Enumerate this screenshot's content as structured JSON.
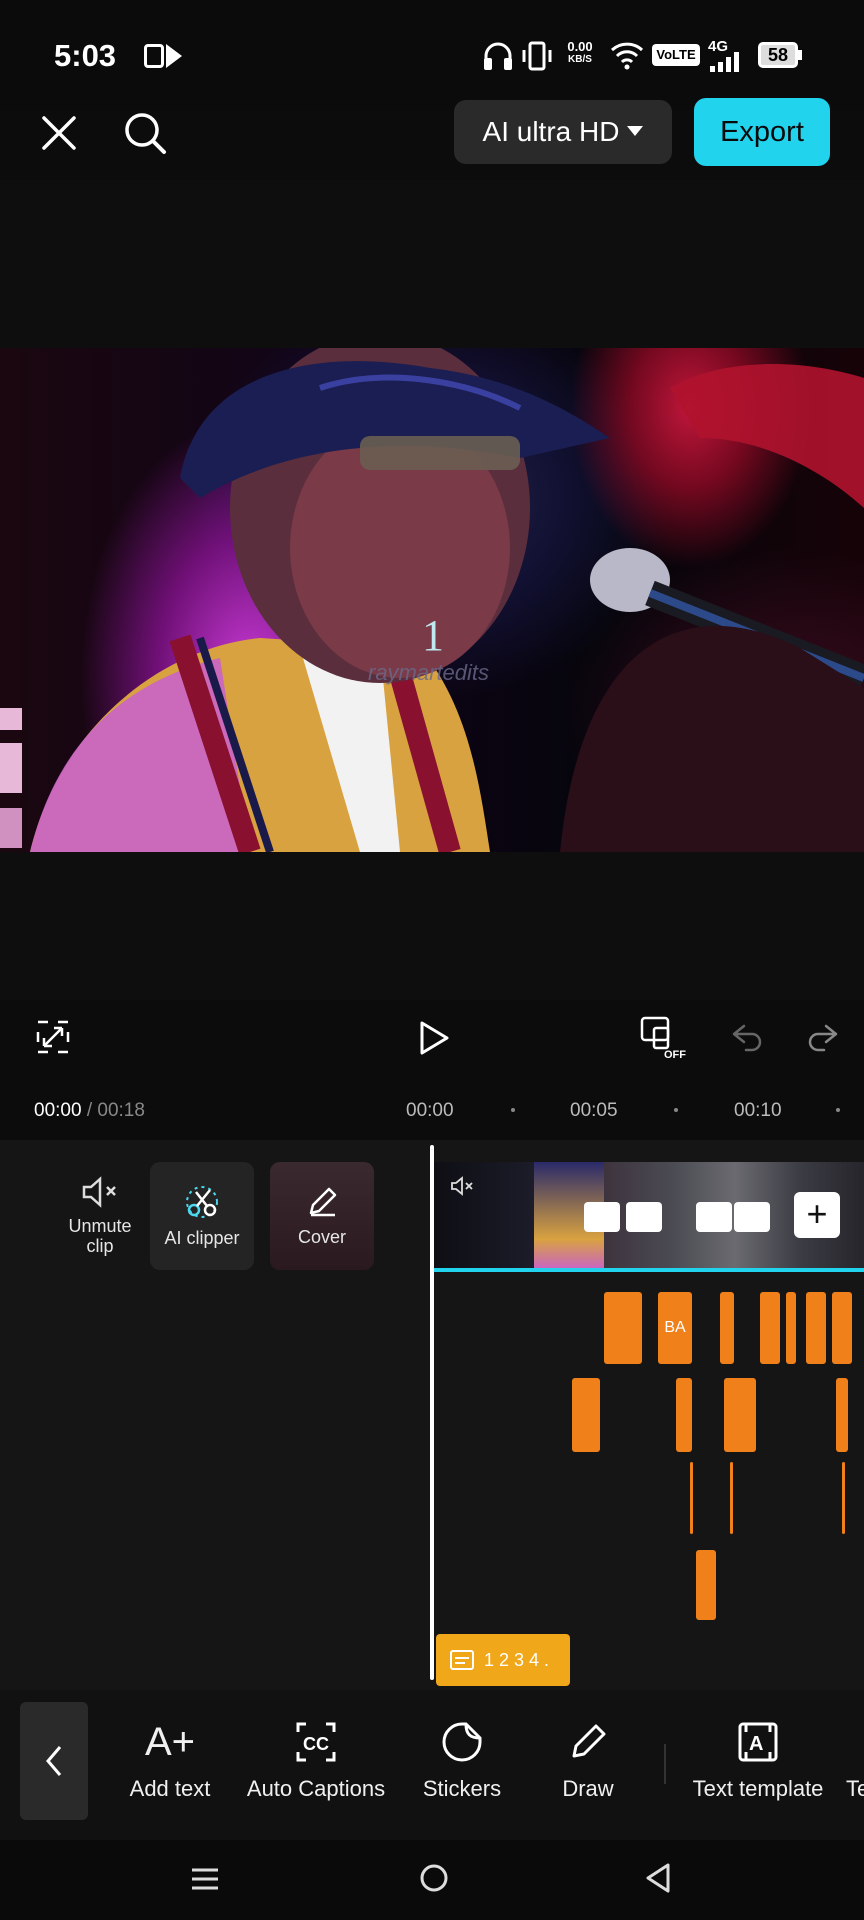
{
  "status_bar": {
    "time": "5:03",
    "net_speed_value": "0.00",
    "net_speed_unit": "KB/S",
    "volte": "VoLTE",
    "network": "4G",
    "battery": "58",
    "icons": [
      "headphones-icon",
      "vibrate-icon",
      "wifi-icon",
      "signal-icon",
      "battery-icon"
    ]
  },
  "top_bar": {
    "quality_label": "AI ultra HD",
    "export_label": "Export"
  },
  "preview": {
    "overlay_number": "1",
    "watermark": "raymartedits"
  },
  "playback": {
    "current_time": "00:00",
    "separator": " / ",
    "total_time": "00:18",
    "ruler": [
      "00:00",
      "00:05",
      "00:10"
    ]
  },
  "clip_tools": [
    {
      "label": "Unmute clip",
      "icon": "speaker-muted-icon"
    },
    {
      "label": "AI clipper",
      "icon": "ai-scissors-icon"
    },
    {
      "label": "Cover",
      "icon": "pencil-icon"
    }
  ],
  "caption_clip": {
    "text": "1 2 3 4 ."
  },
  "caption_fragment": "BA",
  "toolbar": {
    "items": [
      {
        "label": "Add text",
        "icon": "add-text-icon"
      },
      {
        "label": "Auto Captions",
        "icon": "captions-icon"
      },
      {
        "label": "Stickers",
        "icon": "sticker-icon"
      },
      {
        "label": "Draw",
        "icon": "pencil-icon"
      },
      {
        "label": "Text template",
        "icon": "text-template-icon"
      },
      {
        "label": "Te",
        "icon": ""
      }
    ]
  },
  "colors": {
    "accent": "#22d3ee",
    "track": "#f0801a",
    "caption": "#f0a81a"
  }
}
